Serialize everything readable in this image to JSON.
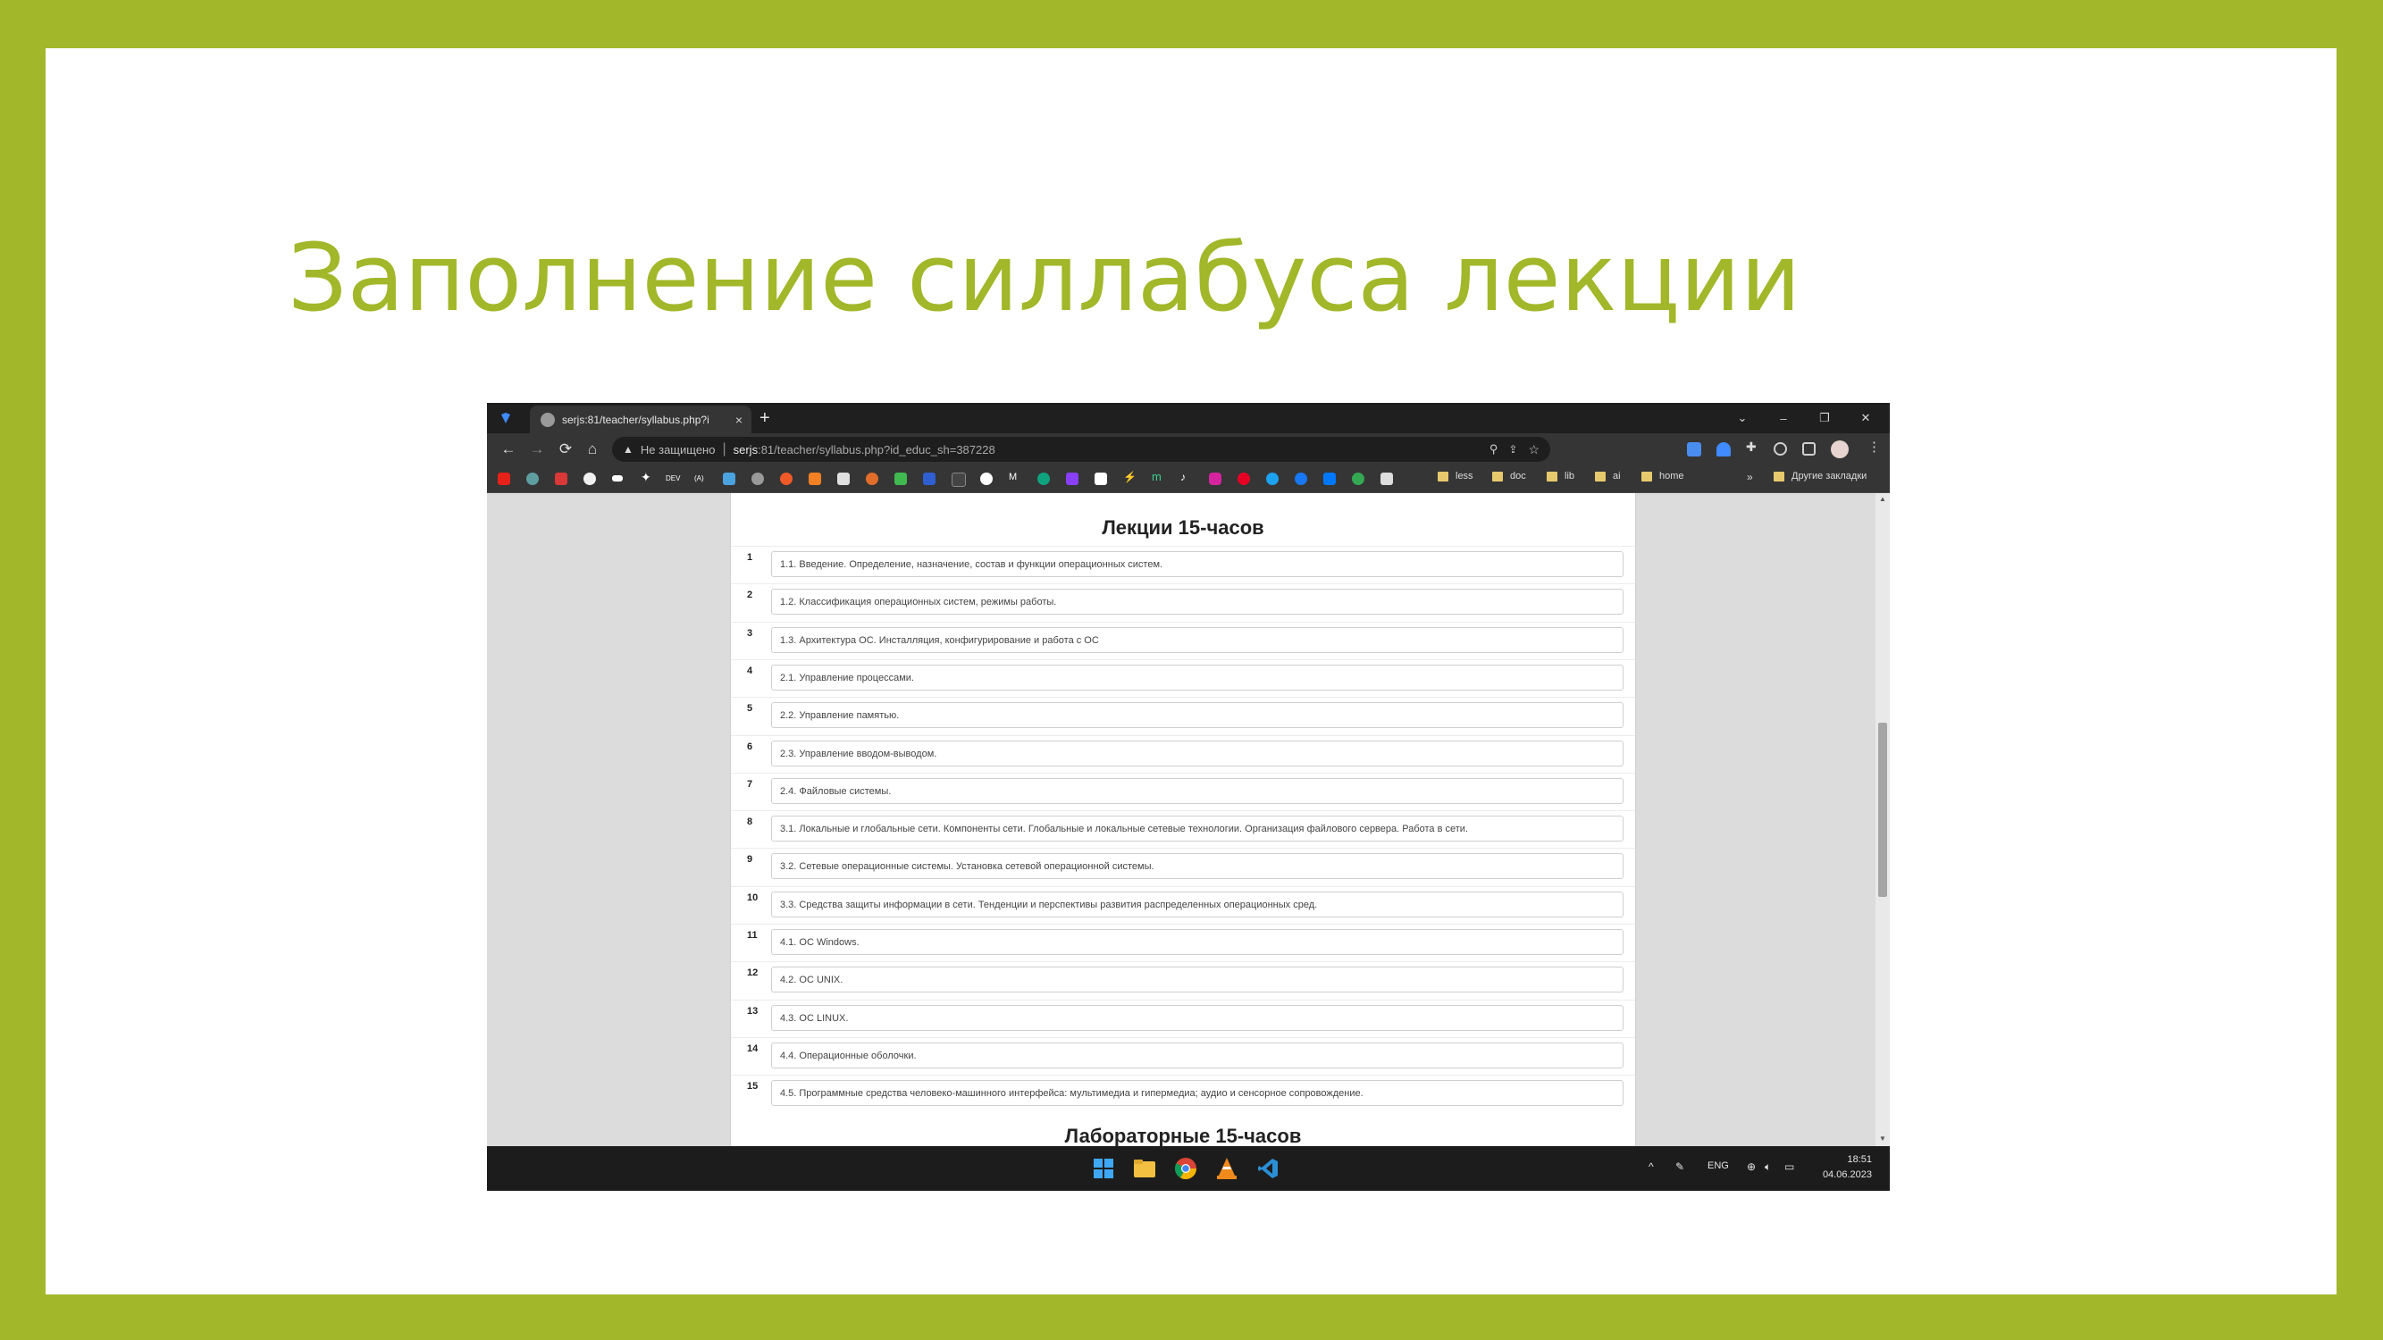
{
  "slide": {
    "title": "Заполнение силлабуса лекции"
  },
  "browser": {
    "tab": {
      "title": "serjs:81/teacher/syllabus.php?i",
      "close_glyph": "×"
    },
    "new_tab_glyph": "+",
    "window_controls": {
      "dropdown": "⌄",
      "minimize": "–",
      "restore": "❐",
      "close": "✕"
    },
    "nav": {
      "back": "←",
      "forward": "→",
      "reload": "⟳",
      "home": "⌂"
    },
    "address": {
      "security_text": "Не защищено",
      "url_host": "serjs",
      "url_rest": ":81/teacher/syllabus.php?id_educ_sh=387228"
    },
    "bookmark_folders": [
      "less",
      "doc",
      "lib",
      "ai",
      "home"
    ],
    "more_bookmarks": "»",
    "other_bookmarks": "Другие закладки",
    "icons": {
      "search": "search-icon",
      "share": "share-icon",
      "star": "star-icon",
      "extensions": "puzzle-icon",
      "sidebar": "side-panel-icon",
      "menu": "kebab-menu-icon"
    }
  },
  "page": {
    "lectures_heading": "Лекции 15-часов",
    "labs_heading": "Лабораторные 15-часов",
    "lectures": [
      {
        "n": "1",
        "text": "1.1. Введение. Определение, назначение, состав и функции операционных систем."
      },
      {
        "n": "2",
        "text": "1.2. Классификация операционных систем, режимы работы."
      },
      {
        "n": "3",
        "text": "1.3. Архитектура ОС. Инсталляция, конфигурирование и работа с ОС"
      },
      {
        "n": "4",
        "text": "2.1. Управление процессами."
      },
      {
        "n": "5",
        "text": "2.2. Управление памятью."
      },
      {
        "n": "6",
        "text": "2.3. Управление вводом-выводом."
      },
      {
        "n": "7",
        "text": "2.4. Файловые системы."
      },
      {
        "n": "8",
        "text": "3.1. Локальные и глобальные сети. Компоненты сети. Глобальные и локальные сетевые технологии. Организация файлового сервера. Работа в сети."
      },
      {
        "n": "9",
        "text": "3.2. Сетевые операционные системы. Установка сетевой операционной системы."
      },
      {
        "n": "10",
        "text": "3.3. Средства защиты информации в сети. Тенденции и перспективы развития распределенных операционных сред."
      },
      {
        "n": "11",
        "text": "4.1. ОС Windows."
      },
      {
        "n": "12",
        "text": "4.2. ОС UNIX."
      },
      {
        "n": "13",
        "text": "4.3. ОС LINUX."
      },
      {
        "n": "14",
        "text": "4.4. Операционные оболочки."
      },
      {
        "n": "15",
        "text": "4.5. Программные средства человеко-машинного интерфейса: мультимедиа и гипермедиа; аудио и сенсорное сопровождение."
      }
    ]
  },
  "taskbar": {
    "language": "ENG",
    "time": "18:51",
    "date": "04.06.2023",
    "tray_chevron": "^"
  }
}
